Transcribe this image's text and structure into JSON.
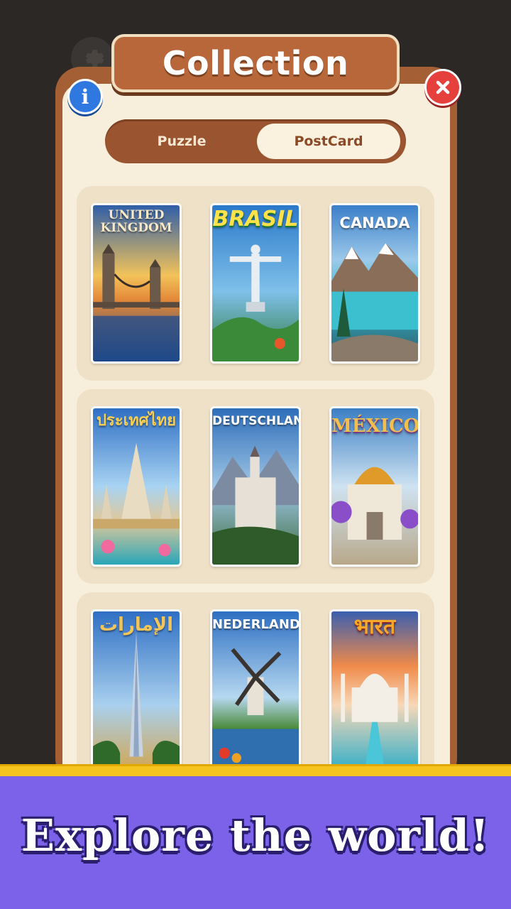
{
  "title": "Collection",
  "tabs": {
    "puzzle": "Puzzle",
    "postcard": "PostCard",
    "selected": "PostCard"
  },
  "cards": [
    {
      "title": "UNITED KINGDOM"
    },
    {
      "title": "BRASIL"
    },
    {
      "title": "CANADA"
    },
    {
      "title": "ประเทศไทย"
    },
    {
      "title": "DEUTSCHLAND"
    },
    {
      "title": "MÉXICO"
    },
    {
      "title": "الإمارات"
    },
    {
      "title": "NEDERLAND"
    },
    {
      "title": "भारत"
    }
  ],
  "banner": {
    "text": "Explore the world!"
  },
  "colors": {
    "frame": "#a55f35",
    "panel": "#f7eedc",
    "banner": "#7b62e8",
    "accent_yellow": "#f5c41f"
  },
  "icons": [
    "gear-icon",
    "info-icon",
    "close-icon"
  ]
}
